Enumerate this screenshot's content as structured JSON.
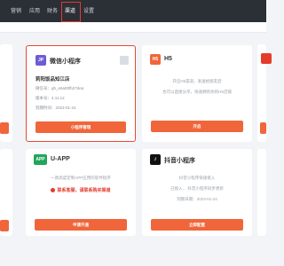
{
  "nav": {
    "items": [
      "营销",
      "应用",
      "财务",
      "渠道",
      "设置"
    ],
    "active": "渠道"
  },
  "cards": {
    "wechat": {
      "icon": "JP",
      "title": "微信小程序",
      "name": "莉阳饭品知江店",
      "appid": "微信号：gh_e6a00fb27dea",
      "version": "版本号：4.11.12",
      "expire": "到期时间：2023-01-24",
      "button": "小程序管理"
    },
    "h5": {
      "icon": "H5",
      "title": "H5",
      "desc_line1": "开启H5渠道，发送给朋友后",
      "desc_line2": "也可以直接分享，快速拥有你的H5店铺",
      "button": "开启"
    },
    "uapp": {
      "icon": "APP",
      "title": "U-APP",
      "desc": "一款高度定制APP应用的软件程序",
      "notice": "联系客服，请联系购买渠道",
      "button": "申请开通"
    },
    "douyin": {
      "title": "抖音小程序",
      "desc_line1": "抖音小程序快速接入",
      "desc_line2": "已接入… 抖音小程序同步更新",
      "desc_line3": "到期日期：2023-01-24",
      "button": "立即配置"
    }
  },
  "colors": {
    "accent": "#f0663a",
    "highlight_border": "#e44a33",
    "nav_bg": "#2b2f36",
    "wechat_icon": "#6c5dd3",
    "h5_icon": "#f0663a",
    "uapp_icon": "#22a45d"
  }
}
